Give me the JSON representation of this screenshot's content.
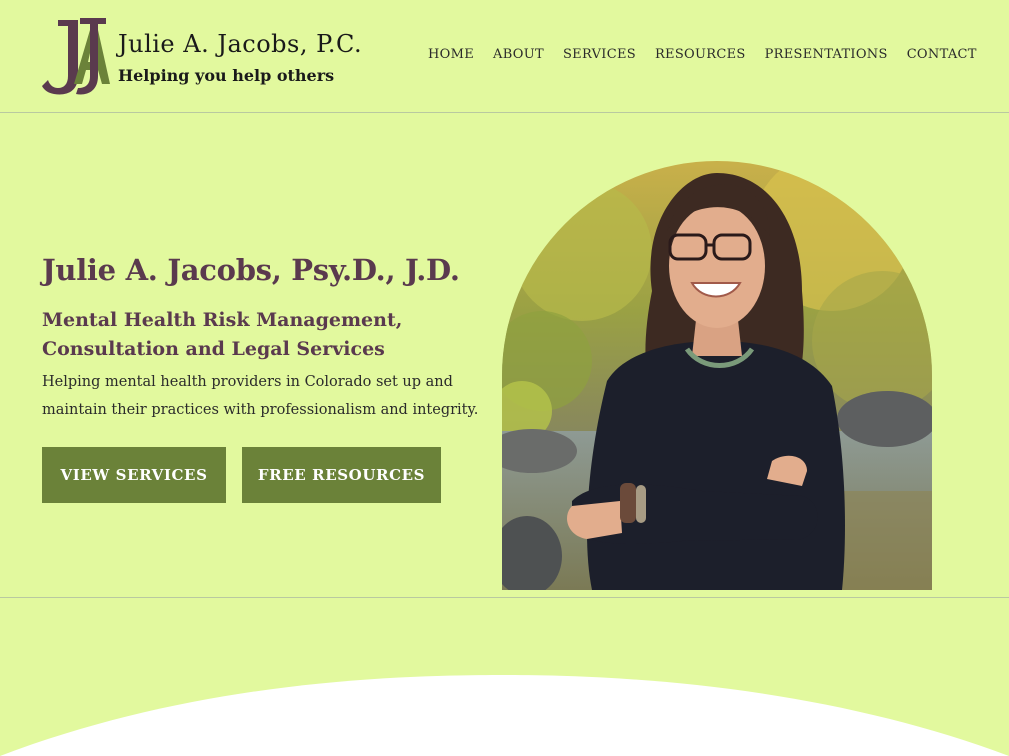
{
  "brand": {
    "name": "Julie A. Jacobs, P.C.",
    "tagline": "Helping you help others",
    "logo_colors": {
      "primary": "#5a3a4e",
      "secondary": "#6b8239"
    }
  },
  "nav": {
    "items": [
      "HOME",
      "ABOUT",
      "SERVICES",
      "RESOURCES",
      "PRESENTATIONS",
      "CONTACT"
    ]
  },
  "hero": {
    "title": "Julie A. Jacobs, Psy.D., J.D.",
    "subtitle": "Mental Health Risk Management, Consultation and Legal Services",
    "description": "Helping mental health providers in Colorado set up and maintain their practices with professionalism and integrity.",
    "buttons": {
      "services": "VIEW SERVICES",
      "resources": "FREE RESOURCES"
    },
    "photo_icon": "portrait-photo"
  },
  "colors": {
    "background": "#e2f99e",
    "accent_text": "#5a3a4e",
    "button": "#6b8239"
  }
}
